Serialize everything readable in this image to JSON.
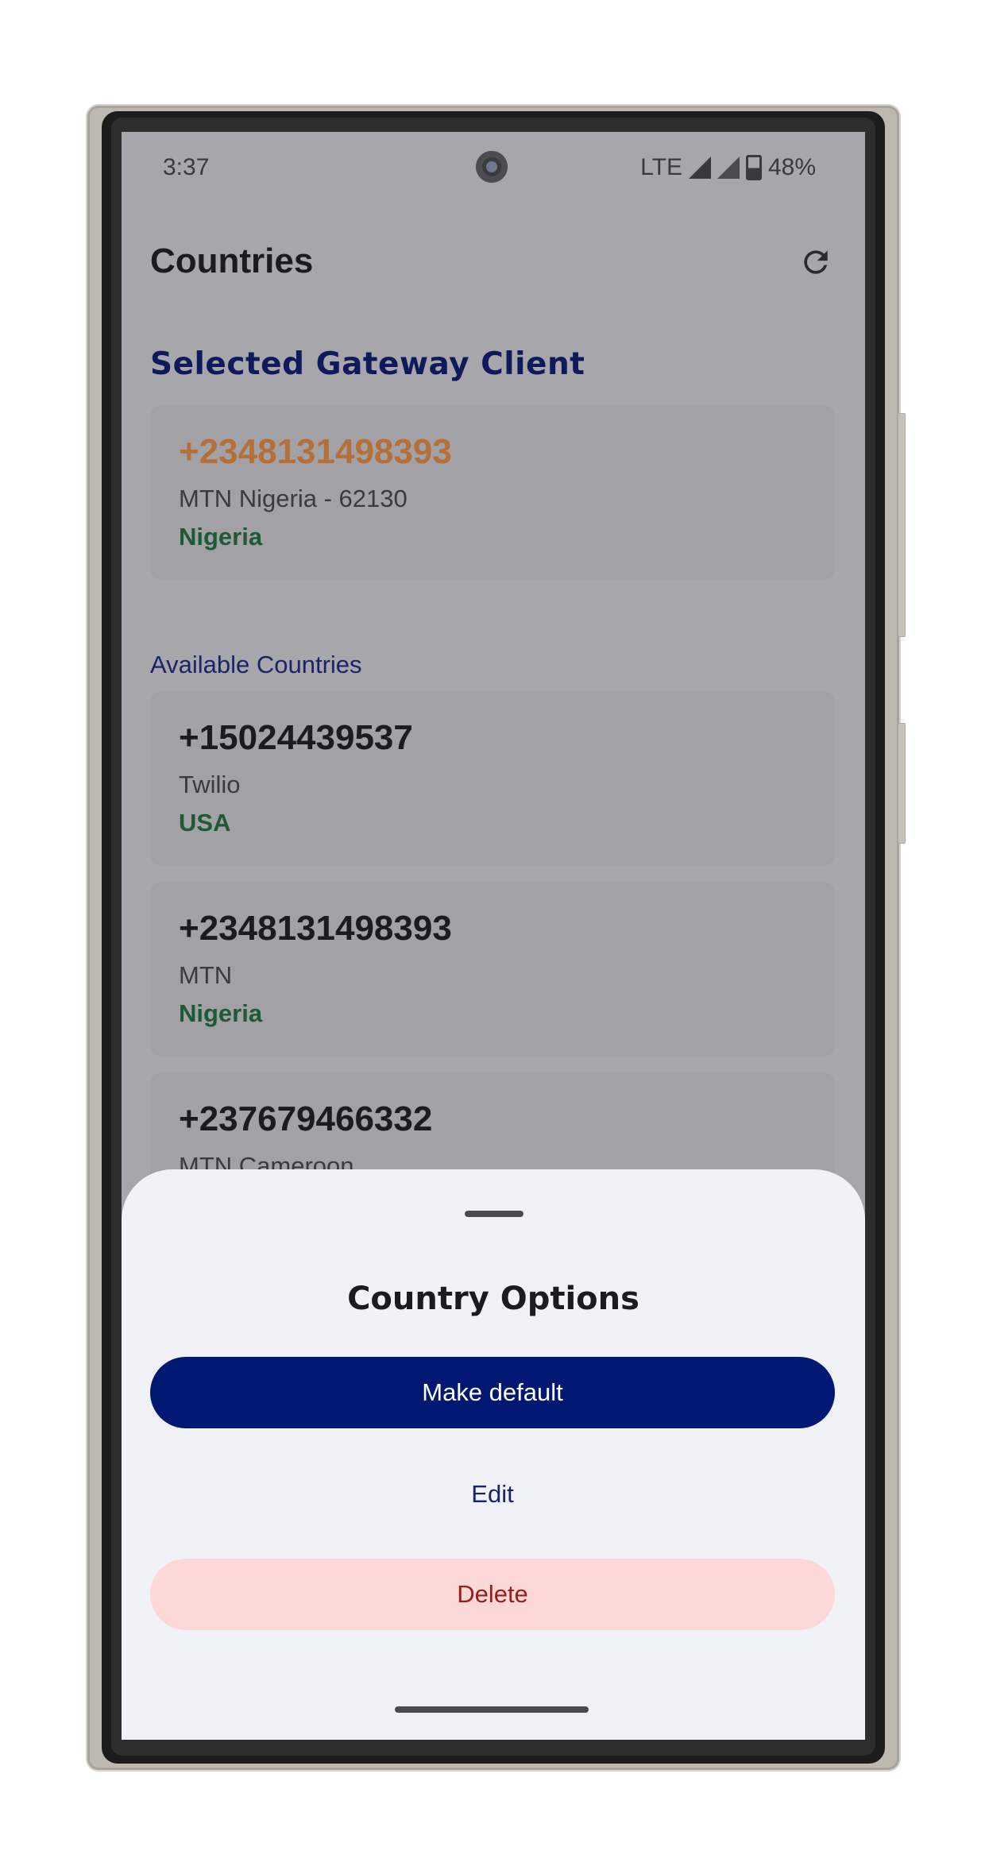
{
  "status_bar": {
    "time": "3:37",
    "network": "LTE",
    "battery": "48%"
  },
  "app_bar": {
    "title": "Countries",
    "refresh_icon": "refresh-icon"
  },
  "selected_section": {
    "title": "Selected Gateway Client",
    "card": {
      "number": "+2348131498393",
      "operator": "MTN Nigeria - 62130",
      "country": "Nigeria"
    }
  },
  "available_section": {
    "label": "Available Countries",
    "items": [
      {
        "number": "+15024439537",
        "operator": "Twilio",
        "country": "USA"
      },
      {
        "number": "+2348131498393",
        "operator": "MTN",
        "country": "Nigeria"
      },
      {
        "number": "+237679466332",
        "operator": "MTN Cameroon",
        "country": ""
      }
    ]
  },
  "sheet": {
    "title": "Country Options",
    "make_default": "Make default",
    "edit": "Edit",
    "delete": "Delete"
  },
  "colors": {
    "primary": "#001871",
    "selected_number": "#b5703a",
    "country_text": "#1f5a37",
    "delete_bg": "#fdd8d8",
    "delete_text": "#9b1c1c"
  }
}
